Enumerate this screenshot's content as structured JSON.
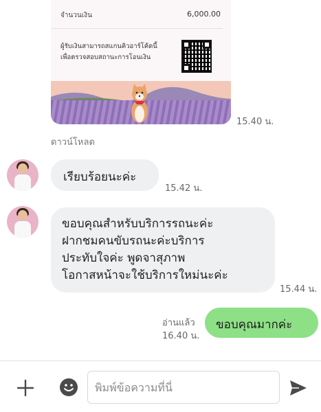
{
  "slip": {
    "amount_label": "จำนวนเงิน",
    "amount_value": "6,000.00",
    "caption_line1": "ผู้รับเงินสามารถสแกนคิวอาร์โค้ดนี้",
    "caption_line2": "เพื่อตรวจสอบสถานะการโอนเงิน",
    "time": "15.40 น.",
    "download_label": "ดาวน์โหลด"
  },
  "messages": {
    "msg1": {
      "text": "เรียบร้อยนะค่ะ",
      "time": "15.42 น."
    },
    "msg2": {
      "lines": [
        "ขอบคุณสำหรับบริการรถนะค่ะ",
        "ฝากชมคนขับรถนะค่ะบริการ",
        "ประทับใจค่ะ พูดจาสุภาพ",
        "โอกาสหน้าจะใช้บริการใหม่นะค่ะ"
      ],
      "time": "15.44 น."
    },
    "msg3": {
      "text": "ขอบคุณมากค่ะ",
      "read_label": "อ่านแล้ว",
      "time": "16.40 น."
    }
  },
  "input_bar": {
    "placeholder": "พิมพ์ข้อความที่นี่",
    "icons": {
      "add": "plus-icon",
      "emoji": "emoji-icon",
      "send": "send-icon"
    }
  },
  "colors": {
    "incoming_bubble": "#eef0f2",
    "outgoing_bubble": "#8de086",
    "icon_gray": "#4a4a4a"
  }
}
